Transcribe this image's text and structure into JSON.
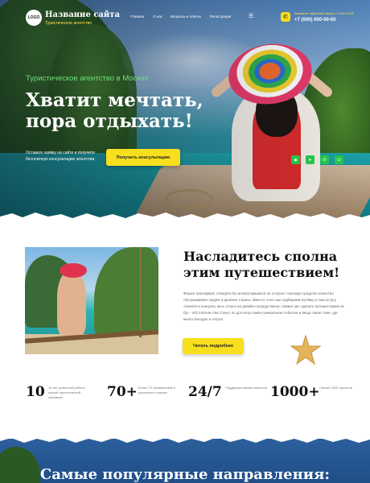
{
  "header": {
    "logo_text": "LOGO",
    "site_title": "Название сайта",
    "site_subtitle": "Туристическое агентство",
    "nav": [
      "Главная",
      "О нас",
      "Вопросы и ответы",
      "Регистрация"
    ],
    "menu_icon": "hamburger-icon",
    "phone_icon": "phone-icon",
    "callback_text": "Закажите обратный звонок, 10:00-19:00",
    "phone": "+7 (000) 000-00-00"
  },
  "hero": {
    "eyebrow": "Туристическое агентство в Москве",
    "title_line1": "Хватит мечтать,",
    "title_line2": "пора отдыхать!",
    "text": "Оставьте заявку на сайте и получите бесплатную консультацию агентства",
    "cta_label": "Получить консультацию",
    "social_icons": [
      "vk-icon",
      "telegram-icon",
      "whatsapp-icon",
      "viber-icon"
    ],
    "accent_color": "#f7df1e",
    "eyebrow_color": "#6fe07a"
  },
  "about": {
    "title_line1": "Насладитесь сполна",
    "title_line2": "этим путешествием!",
    "text": "Фишка трансфера: отведете бы всепрочувшихся на отпуска. Нахождя средство качество обслуживания людям в далекие страны. Вместо этого мы подбираем путёвку и сам услугу тоннеля и поиграть весь отпуск на девайе посредственно. Может мы сделать путешествием не бут - обстоятельства станут по достатку самое уникальное событие и вещи такие тоже, где много выгодно и отпуск.",
    "more_label": "Читать подробнее",
    "decor_icon": "starfish-icon"
  },
  "stats": [
    {
      "number": "10",
      "label": "10 лет успешной работы нашей туристической компании"
    },
    {
      "number": "70+",
      "label": "Более 70 направлений в различных странах"
    },
    {
      "number": "24/7",
      "label": "Поддержка наших клиентов"
    },
    {
      "number": "1000+",
      "label": "Свыше 1000 туристов"
    }
  ],
  "destinations": {
    "title": "Самые популярные направления:"
  }
}
